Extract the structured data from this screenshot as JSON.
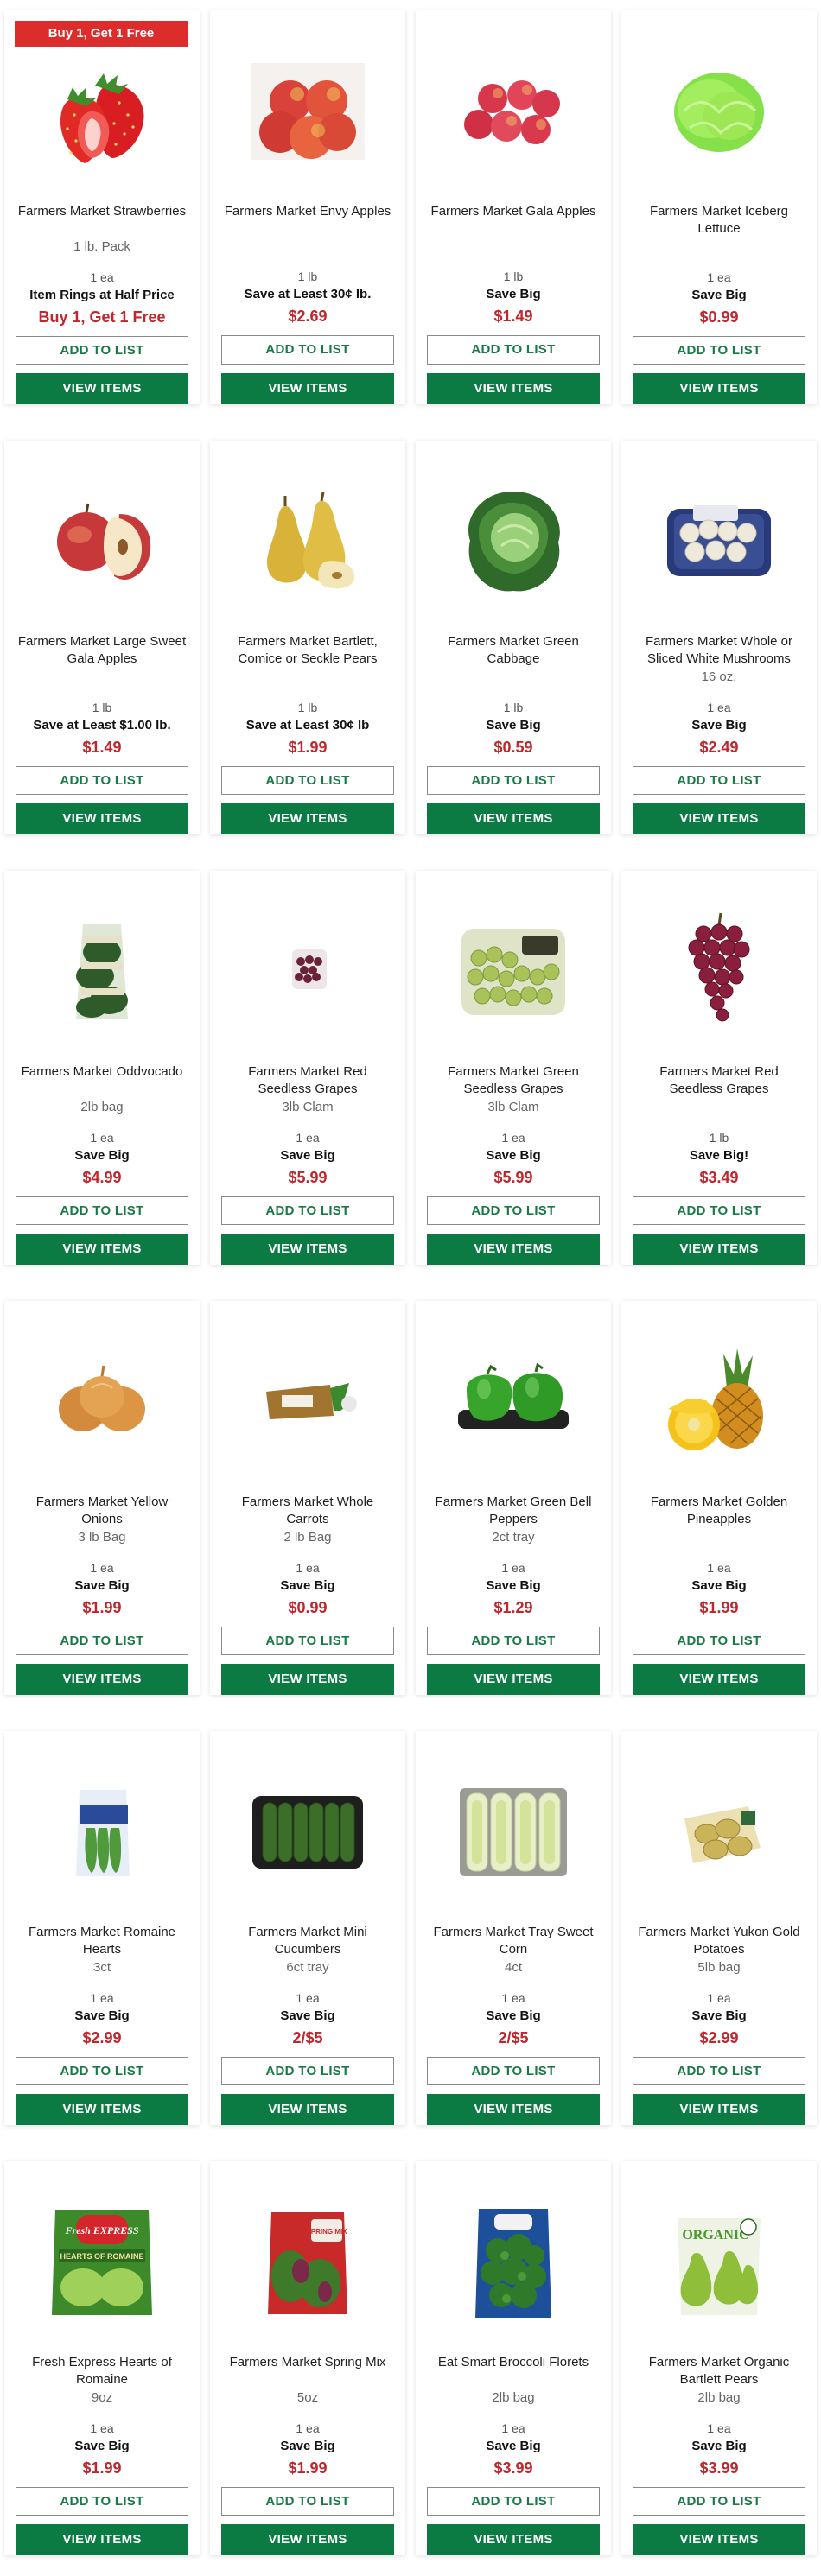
{
  "products": [
    {
      "name": "Farmers Market Strawberries",
      "size": "1 lb. Pack",
      "unit": "1 ea",
      "deal": "Item Rings at Half Price",
      "price": "Buy 1, Get 1 Free",
      "badge": "Buy 1, Get 1 Free",
      "icon": "strawberries-image"
    },
    {
      "name": "Farmers Market Envy Apples",
      "size": "",
      "unit": "1 lb",
      "deal": "Save at Least 30¢ lb.",
      "price": "$2.69",
      "icon": "envy-apples-image"
    },
    {
      "name": "Farmers Market Gala Apples",
      "size": "",
      "unit": "1 lb",
      "deal": "Save Big",
      "price": "$1.49",
      "icon": "gala-apples-image"
    },
    {
      "name": "Farmers Market Iceberg Lettuce",
      "size": "",
      "unit": "1 ea",
      "deal": "Save Big",
      "price": "$0.99",
      "icon": "iceberg-lettuce-image"
    },
    {
      "name": "Farmers Market Large Sweet Gala Apples",
      "size": "",
      "unit": "1 lb",
      "deal": "Save at Least $1.00 lb.",
      "price": "$1.49",
      "icon": "large-gala-apples-image"
    },
    {
      "name": "Farmers Market Bartlett, Comice or Seckle Pears",
      "size": "",
      "unit": "1 lb",
      "deal": "Save at Least 30¢ lb",
      "price": "$1.99",
      "icon": "pears-image"
    },
    {
      "name": "Farmers Market Green Cabbage",
      "size": "",
      "unit": "1 lb",
      "deal": "Save Big",
      "price": "$0.59",
      "icon": "green-cabbage-image"
    },
    {
      "name": "Farmers Market Whole or Sliced White Mushrooms",
      "size": "16 oz.",
      "unit": "1 ea",
      "deal": "Save Big",
      "price": "$2.49",
      "icon": "mushrooms-image"
    },
    {
      "name": "Farmers Market Oddvocado",
      "size": "2lb bag",
      "unit": "1 ea",
      "deal": "Save Big",
      "price": "$4.99",
      "icon": "avocado-bag-image"
    },
    {
      "name": "Farmers Market Red Seedless Grapes",
      "size": "3lb Clam",
      "unit": "1 ea",
      "deal": "Save Big",
      "price": "$5.99",
      "icon": "red-grapes-clam-image"
    },
    {
      "name": "Farmers Market Green Seedless Grapes",
      "size": "3lb Clam",
      "unit": "1 ea",
      "deal": "Save Big",
      "price": "$5.99",
      "icon": "green-grapes-clam-image"
    },
    {
      "name": "Farmers Market Red Seedless Grapes",
      "size": "",
      "unit": "1 lb",
      "deal": "Save Big!",
      "price": "$3.49",
      "icon": "red-grapes-image"
    },
    {
      "name": "Farmers Market Yellow Onions",
      "size": "3 lb Bag",
      "unit": "1 ea",
      "deal": "Save Big",
      "price": "$1.99",
      "icon": "yellow-onions-image"
    },
    {
      "name": "Farmers Market Whole Carrots",
      "size": "2 lb Bag",
      "unit": "1 ea",
      "deal": "Save Big",
      "price": "$0.99",
      "icon": "carrots-image"
    },
    {
      "name": "Farmers Market Green Bell Peppers",
      "size": "2ct tray",
      "unit": "1 ea",
      "deal": "Save Big",
      "price": "$1.29",
      "icon": "green-peppers-image"
    },
    {
      "name": "Farmers Market Golden Pineapples",
      "size": "",
      "unit": "1 ea",
      "deal": "Save Big",
      "price": "$1.99",
      "icon": "pineapple-image"
    },
    {
      "name": "Farmers Market Romaine Hearts",
      "size": "3ct",
      "unit": "1 ea",
      "deal": "Save Big",
      "price": "$2.99",
      "icon": "romaine-hearts-image"
    },
    {
      "name": "Farmers Market Mini Cucumbers",
      "size": "6ct tray",
      "unit": "1 ea",
      "deal": "Save Big",
      "price": "2/$5",
      "icon": "mini-cucumbers-image"
    },
    {
      "name": "Farmers Market Tray Sweet Corn",
      "size": "4ct",
      "unit": "1 ea",
      "deal": "Save Big",
      "price": "2/$5",
      "icon": "sweet-corn-image"
    },
    {
      "name": "Farmers Market Yukon Gold Potatoes",
      "size": "5lb bag",
      "unit": "1 ea",
      "deal": "Save Big",
      "price": "$2.99",
      "icon": "yukon-potatoes-image"
    },
    {
      "name": "Fresh Express Hearts of Romaine",
      "size": "9oz",
      "unit": "1 ea",
      "deal": "Save Big",
      "price": "$1.99",
      "icon": "fresh-express-romaine-image",
      "pkg_brand": "Fresh EXPRESS",
      "pkg_label": "HEARTS OF ROMAINE"
    },
    {
      "name": "Farmers Market Spring Mix",
      "size": "5oz",
      "unit": "1 ea",
      "deal": "Save Big",
      "price": "$1.99",
      "icon": "spring-mix-image",
      "pkg_label": "SPRING MIX"
    },
    {
      "name": "Eat Smart Broccoli Florets",
      "size": "2lb bag",
      "unit": "1 ea",
      "deal": "Save Big",
      "price": "$3.99",
      "icon": "broccoli-florets-image"
    },
    {
      "name": "Farmers Market Organic Bartlett Pears",
      "size": "2lb bag",
      "unit": "1 ea",
      "deal": "Save Big",
      "price": "$3.99",
      "icon": "organic-pears-image",
      "pkg_label": "ORGANIC"
    }
  ],
  "buttons": {
    "add_to_list": "ADD TO LIST",
    "view_items": "VIEW ITEMS"
  },
  "colors": {
    "price_red": "#c0272d",
    "button_green": "#0b7a43",
    "badge_red": "#dd2c2c"
  }
}
